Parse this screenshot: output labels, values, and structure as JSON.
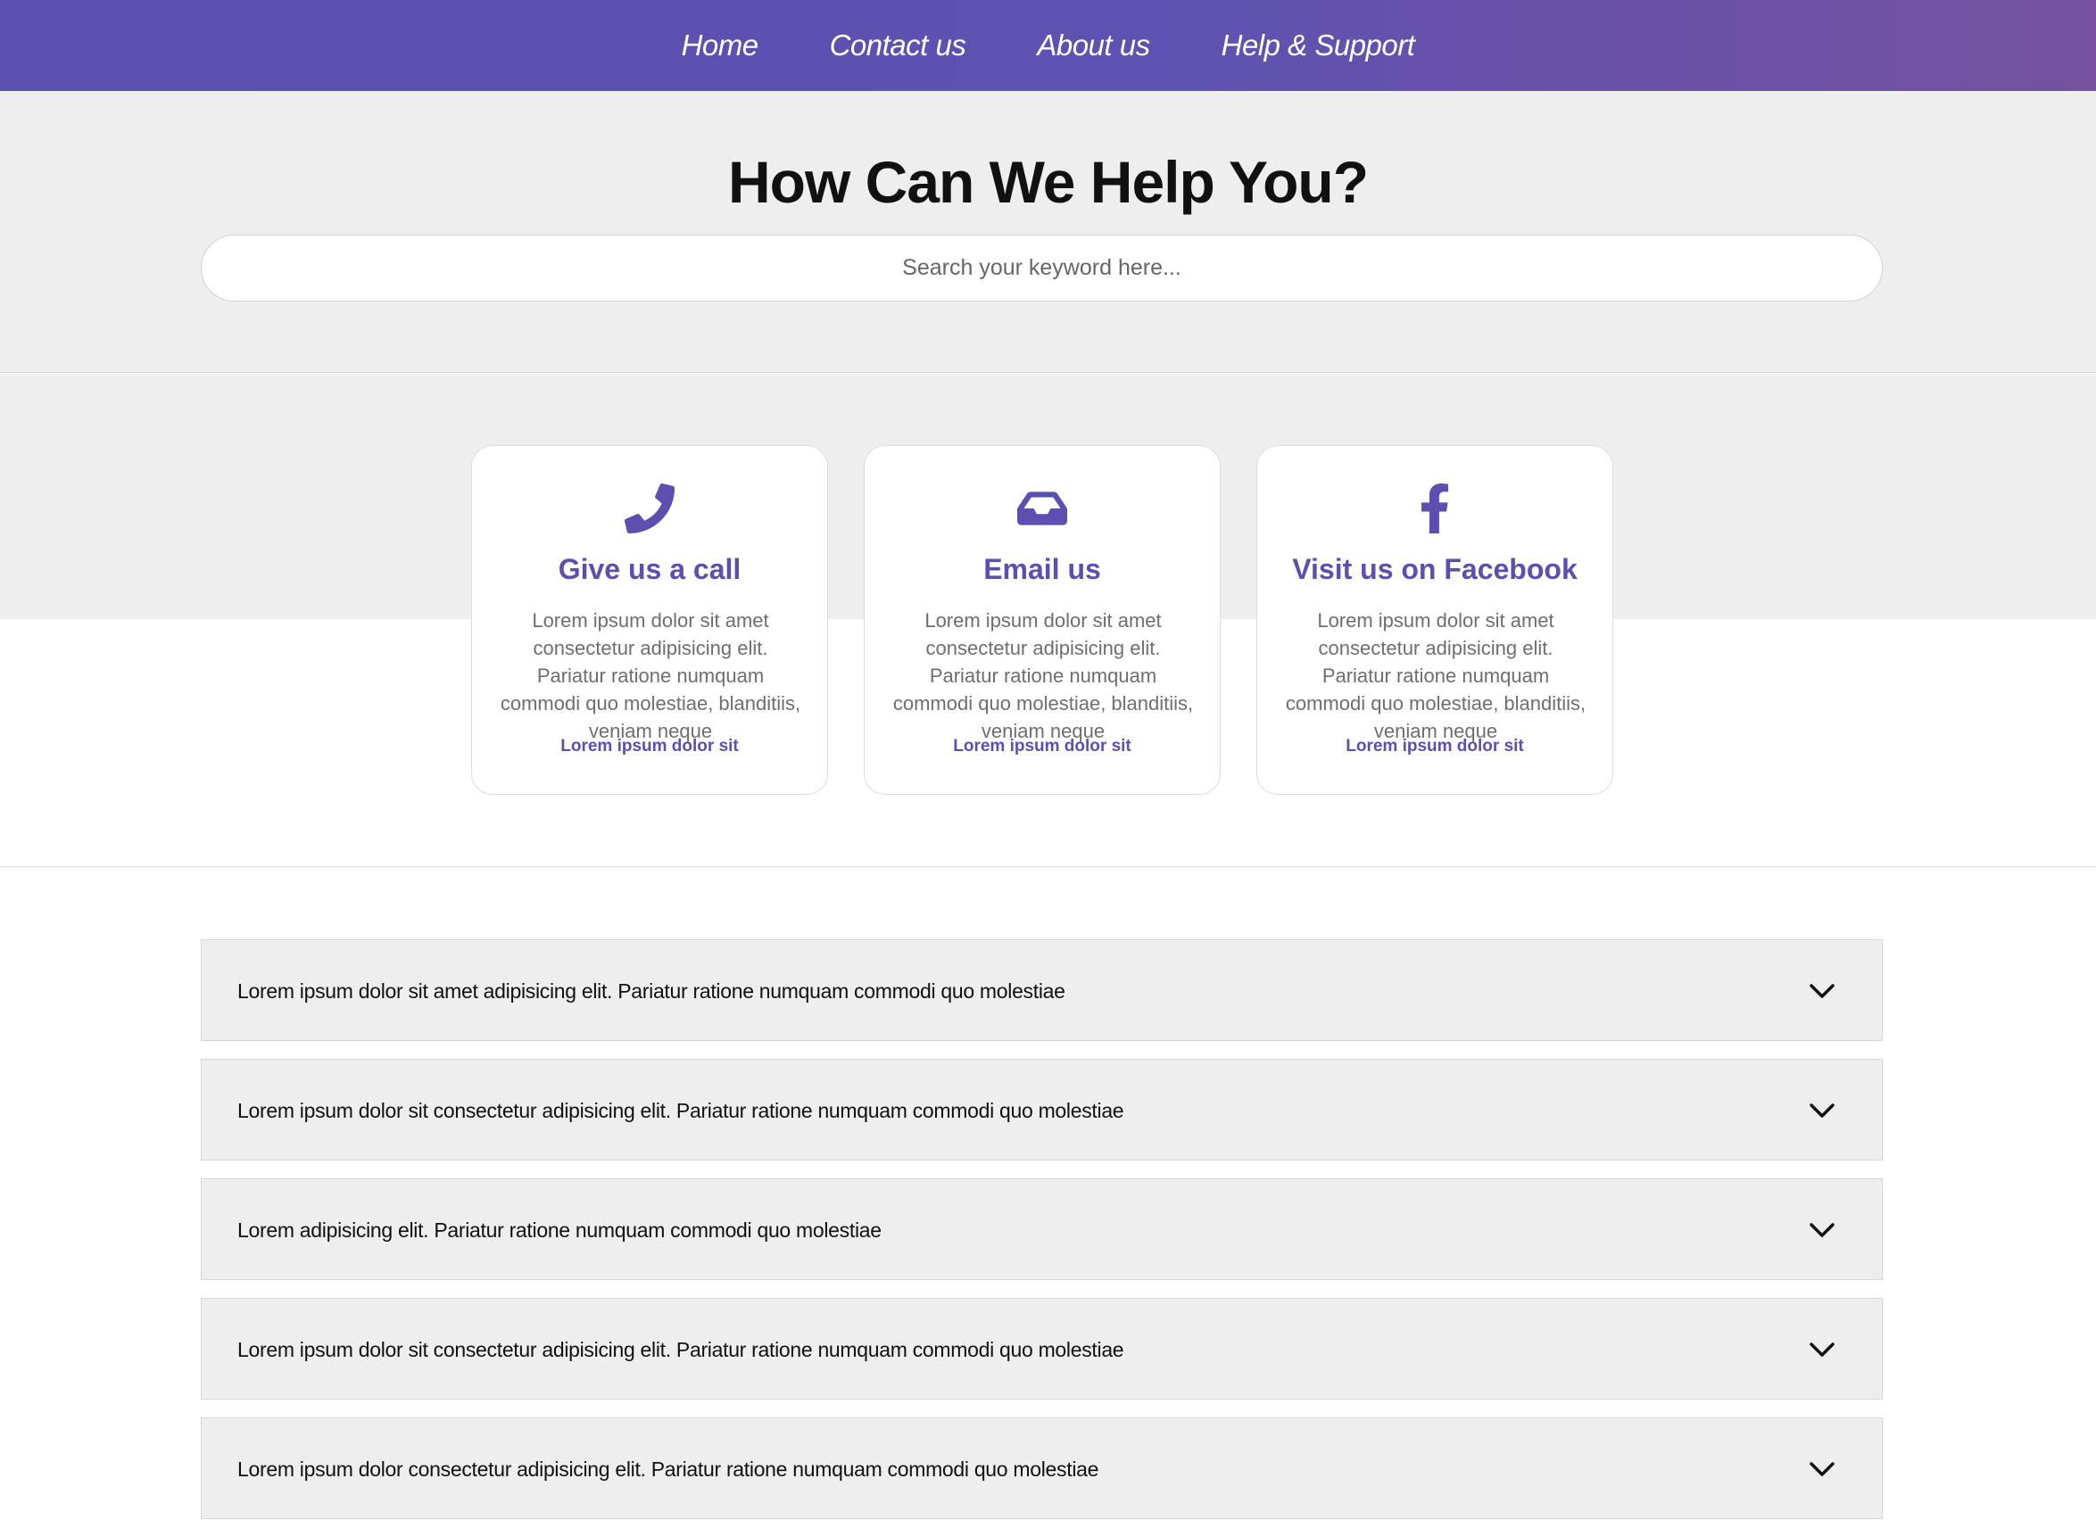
{
  "nav": {
    "items": [
      {
        "label": "Home"
      },
      {
        "label": "Contact us"
      },
      {
        "label": "About us"
      },
      {
        "label": "Help & Support"
      }
    ]
  },
  "hero": {
    "title": "How Can We Help You?",
    "search_placeholder": "Search your keyword here..."
  },
  "cards": [
    {
      "icon": "phone-icon",
      "title": "Give us a call",
      "description": "Lorem ipsum dolor sit amet consectetur adipisicing elit. Pariatur ratione numquam commodi quo molestiae, blanditiis, veniam neque",
      "link": "Lorem ipsum dolor sit"
    },
    {
      "icon": "inbox-icon",
      "title": "Email us",
      "description": "Lorem ipsum dolor sit amet consectetur adipisicing elit. Pariatur ratione numquam commodi quo molestiae, blanditiis, veniam neque",
      "link": "Lorem ipsum dolor sit"
    },
    {
      "icon": "facebook-icon",
      "title": "Visit us on Facebook",
      "description": "Lorem ipsum dolor sit amet consectetur adipisicing elit. Pariatur ratione numquam commodi quo molestiae, blanditiis, veniam neque",
      "link": "Lorem ipsum dolor sit"
    }
  ],
  "faq": [
    {
      "question": "Lorem ipsum dolor sit amet adipisicing elit. Pariatur ratione numquam commodi quo molestiae"
    },
    {
      "question": "Lorem ipsum dolor sit consectetur adipisicing elit. Pariatur ratione numquam commodi quo molestiae"
    },
    {
      "question": "Lorem adipisicing elit. Pariatur ratione numquam commodi quo molestiae"
    },
    {
      "question": "Lorem ipsum dolor sit consectetur adipisicing elit. Pariatur ratione numquam commodi quo molestiae"
    },
    {
      "question": "Lorem ipsum dolor consectetur adipisicing elit. Pariatur ratione numquam commodi quo molestiae"
    }
  ],
  "colors": {
    "accent": "#5b4fb0",
    "nav_gradient_end": "#7652a0",
    "section_bg": "#eeeeee"
  }
}
